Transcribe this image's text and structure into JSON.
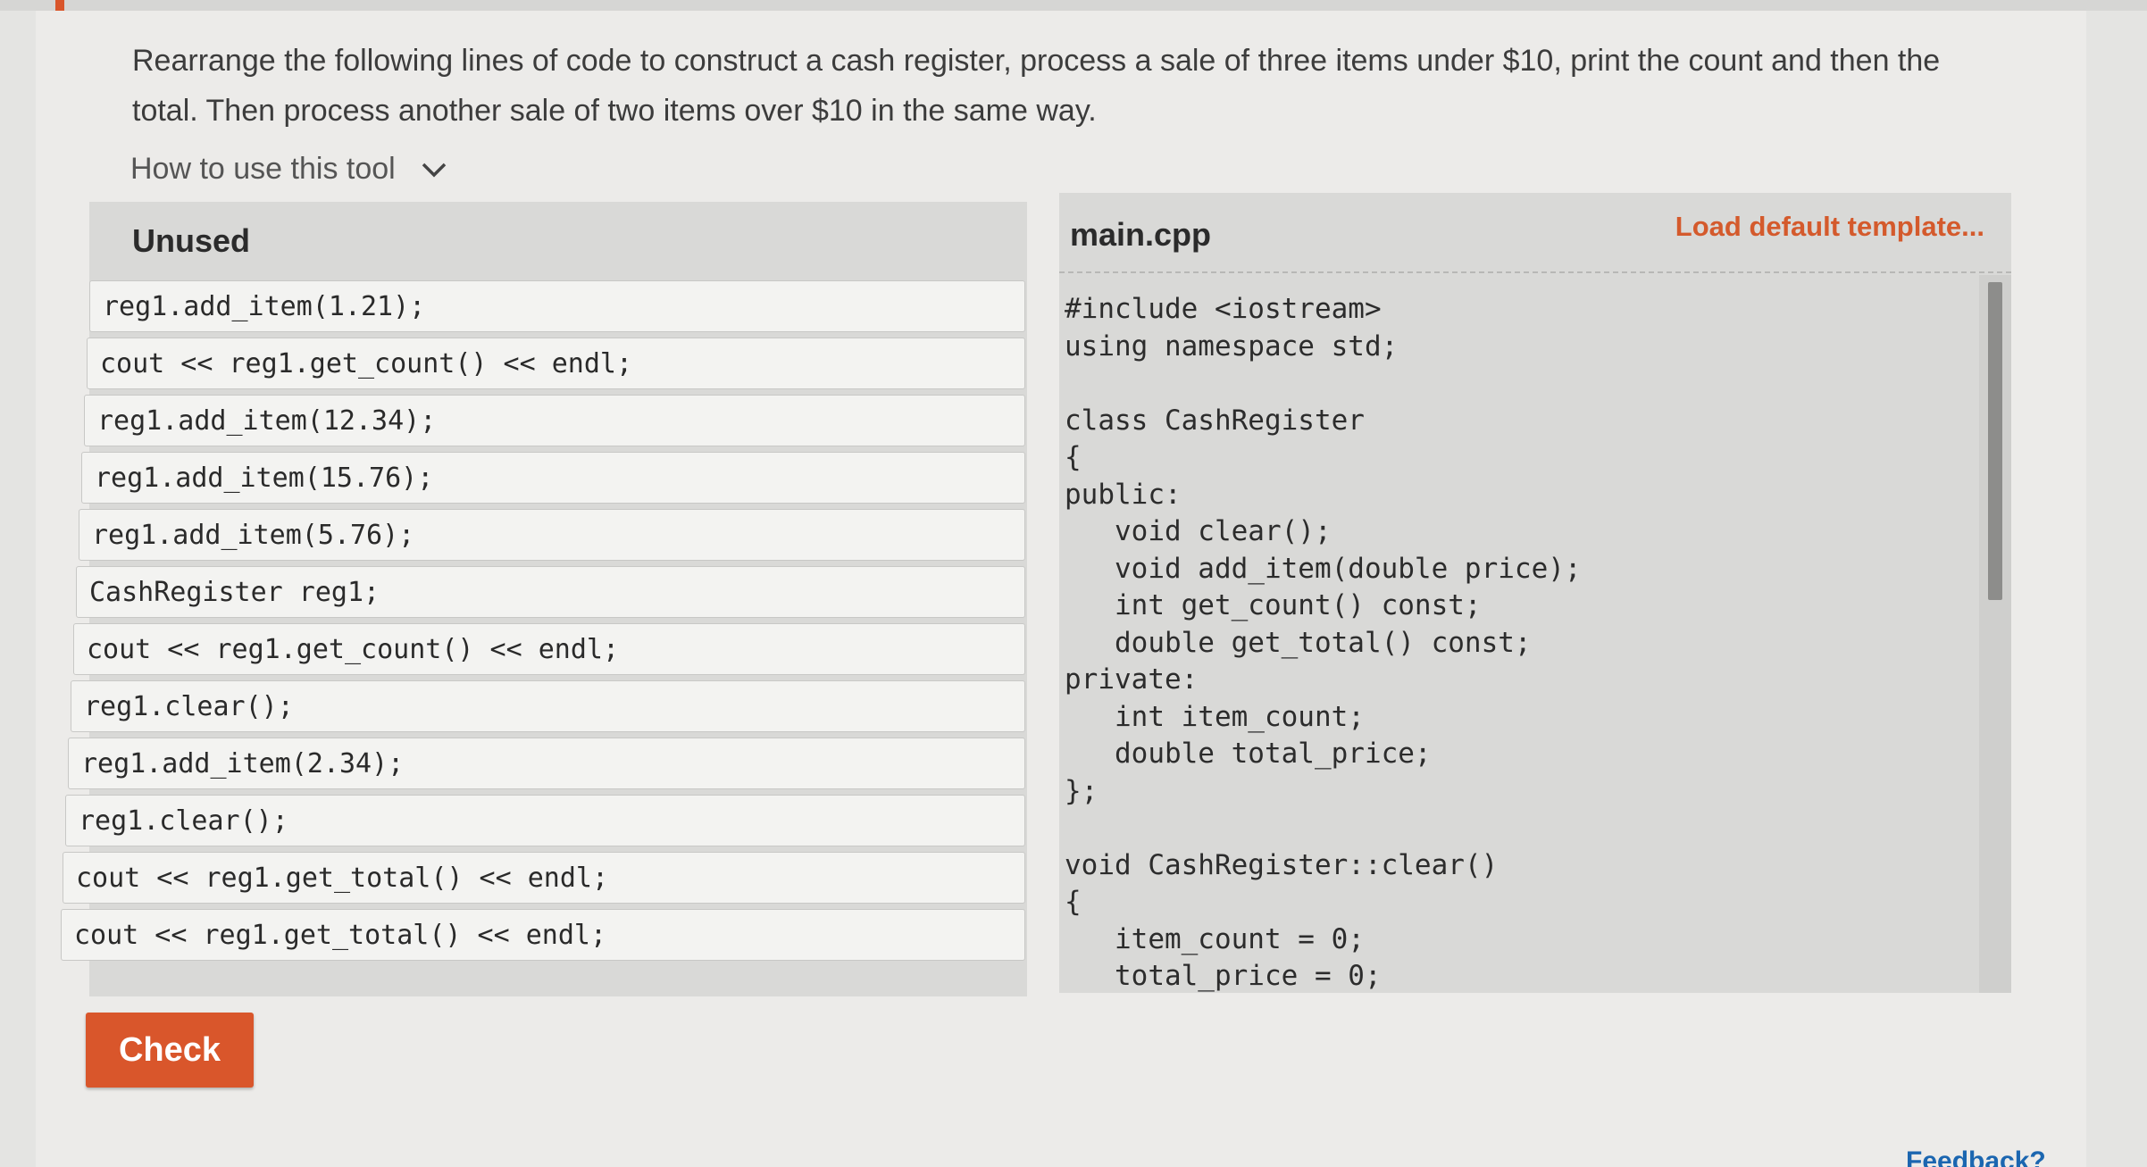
{
  "instructions": "Rearrange the following lines of code to construct a cash register, process a sale of three items under $10, print the count and then the total. Then process another sale of two items over $10 in the same way.",
  "how_to_label": "How to use this tool",
  "unused": {
    "title": "Unused",
    "lines": [
      "reg1.add_item(1.21);",
      "cout << reg1.get_count() << endl;",
      "reg1.add_item(12.34);",
      "reg1.add_item(15.76);",
      "reg1.add_item(5.76);",
      "CashRegister reg1;",
      "cout << reg1.get_count() << endl;",
      "reg1.clear();",
      "reg1.add_item(2.34);",
      "reg1.clear();",
      "cout << reg1.get_total() << endl;",
      "cout << reg1.get_total() << endl;"
    ]
  },
  "editor": {
    "filename": "main.cpp",
    "template_link": "Load default template...",
    "code_lines": [
      "#include <iostream>",
      "using namespace std;",
      "",
      "class CashRegister",
      "{",
      "public:",
      "   void clear();",
      "   void add_item(double price);",
      "   int get_count() const;",
      "   double get_total() const;",
      "private:",
      "   int item_count;",
      "   double total_price;",
      "};",
      "",
      "void CashRegister::clear()",
      "{",
      "   item_count = 0;",
      "   total_price = 0;"
    ]
  },
  "check_label": "Check",
  "feedback_label": "Feedback?",
  "colors": {
    "accent": "#d9562b",
    "link": "#d45a2c"
  }
}
